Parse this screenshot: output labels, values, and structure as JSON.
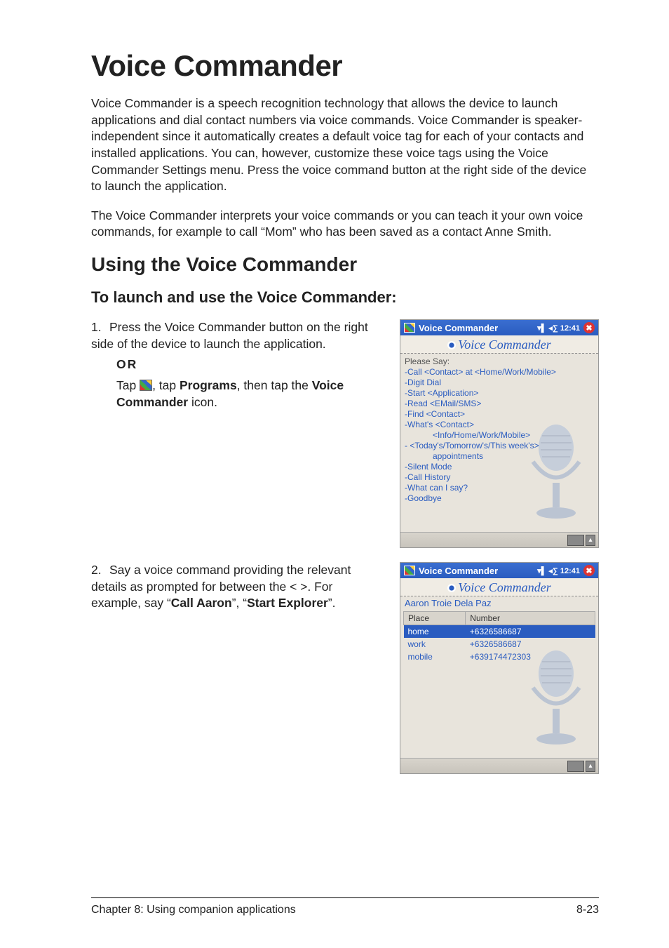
{
  "title": "Voice Commander",
  "para1": "Voice Commander is a speech recognition technology that allows the device to launch applications and dial contact numbers via voice commands. Voice Commander is speaker-independent since it automatically creates a default voice tag for each of your contacts and installed applications. You can, however, customize these voice tags using the Voice Commander Settings menu. Press the voice command button at the right side of the device to launch the application.",
  "para2": "The Voice Commander interprets your voice commands or you can teach it your own voice commands, for example to call “Mom” who has been saved as a contact Anne Smith.",
  "h2": "Using the Voice Commander",
  "h3": "To launch and use the Voice Commander:",
  "step1": {
    "num": "1.",
    "text": "Press the Voice Commander button on the right side of the device to launch the application.",
    "or": "OR",
    "tap_pre": "Tap ",
    "tap_mid": ", tap ",
    "programs": "Programs",
    "tap_post": ", then tap the ",
    "vc": "Voice Commander",
    "icon_post": " icon."
  },
  "step2": {
    "num": "2.",
    "text_pre": "Say a voice command providing the relevant details as prompted for between the < >. For example, say “",
    "call": "Call Aaron",
    "mid": "”, “",
    "start": "Start Explorer",
    "post": "”."
  },
  "shot1": {
    "title": "Voice Commander",
    "status": "▾▌ ◂∑ 12:41",
    "close": "✖",
    "app_header": "Voice Commander",
    "say": "Please Say:",
    "lines": [
      "-Call <Contact> at <Home/Work/Mobile>",
      "-Digit Dial",
      "-Start <Application>",
      "-Read <EMail/SMS>",
      "-Find <Contact>",
      "-What's <Contact>"
    ],
    "sub1": "<Info/Home/Work/Mobile>",
    "line7": "- <Today's/Tomorrow's/This week's>",
    "sub2": "appointments",
    "tail": [
      "-Silent Mode",
      "-Call History",
      "-What can I say?",
      "-Goodbye"
    ]
  },
  "shot2": {
    "title": "Voice Commander",
    "status": "▾▌ ◂∑ 12:41",
    "close": "✖",
    "app_header": "Voice Commander",
    "contact": "Aaron Troie Dela Paz",
    "th1": "Place",
    "th2": "Number",
    "rows": [
      {
        "place": "home",
        "number": "+6326586687",
        "sel": true
      },
      {
        "place": "work",
        "number": "+6326586687",
        "sel": false
      },
      {
        "place": "mobile",
        "number": "+639174472303",
        "sel": false
      }
    ]
  },
  "footer_left": "Chapter 8: Using companion applications",
  "footer_right": "8-23"
}
